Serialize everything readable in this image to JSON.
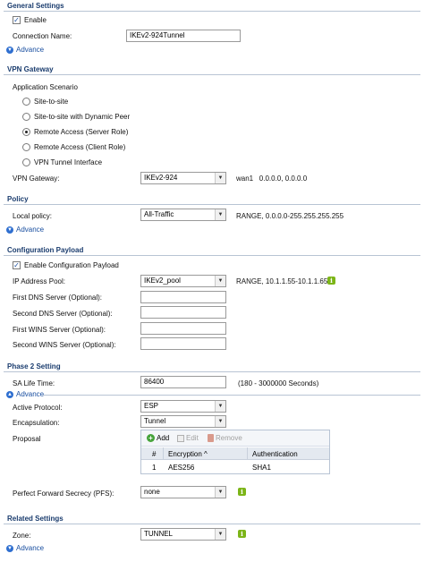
{
  "general": {
    "header": "General Settings",
    "enable_label": "Enable",
    "enable_checked": true,
    "connection_name_label": "Connection Name:",
    "connection_name_value": "IKEv2-924Tunnel",
    "advance_label": "Advance"
  },
  "vpn_gateway": {
    "header": "VPN Gateway",
    "scenario_label": "Application Scenario",
    "options": [
      {
        "label": "Site-to-site",
        "checked": false
      },
      {
        "label": "Site-to-site with Dynamic Peer",
        "checked": false
      },
      {
        "label": "Remote Access (Server Role)",
        "checked": true
      },
      {
        "label": "Remote Access (Client Role)",
        "checked": false
      },
      {
        "label": "VPN Tunnel Interface",
        "checked": false
      }
    ],
    "gateway_label": "VPN Gateway:",
    "gateway_value": "IKEv2-924",
    "gateway_info": "wan1   0.0.0.0, 0.0.0.0"
  },
  "policy": {
    "header": "Policy",
    "local_policy_label": "Local policy:",
    "local_policy_value": "All-Traffic",
    "local_policy_info": "RANGE, 0.0.0.0-255.255.255.255",
    "advance_label": "Advance"
  },
  "config_payload": {
    "header": "Configuration Payload",
    "enable_label": "Enable Configuration Payload",
    "enable_checked": true,
    "ip_pool_label": "IP Address Pool:",
    "ip_pool_value": "IKEv2_pool",
    "ip_pool_info": "RANGE, 10.1.1.55-10.1.1.65",
    "dns1_label": "First DNS Server (Optional):",
    "dns2_label": "Second DNS Server (Optional):",
    "wins1_label": "First WINS Server (Optional):",
    "wins2_label": "Second WINS Server (Optional):"
  },
  "phase2": {
    "header": "Phase 2 Setting",
    "sa_life_label": "SA Life Time:",
    "sa_life_value": "86400",
    "sa_life_info": "(180 - 3000000 Seconds)",
    "advance_label": "Advance",
    "protocol_label": "Active Protocol:",
    "protocol_value": "ESP",
    "encapsulation_label": "Encapsulation:",
    "encapsulation_value": "Tunnel",
    "proposal_label": "Proposal",
    "toolbar": {
      "add": "Add",
      "edit": "Edit",
      "remove": "Remove"
    },
    "table": {
      "headers": [
        "#",
        "Encryption ^",
        "Authentication"
      ],
      "rows": [
        [
          "1",
          "AES256",
          "SHA1"
        ]
      ]
    },
    "pfs_label": "Perfect Forward Secrecy (PFS):",
    "pfs_value": "none"
  },
  "related": {
    "header": "Related Settings",
    "zone_label": "Zone:",
    "zone_value": "TUNNEL",
    "advance_label": "Advance"
  },
  "icons": {
    "info": "i",
    "dropdown": "▼",
    "collapse": "▼",
    "expand": "▲",
    "add": "+",
    "check": "✓"
  },
  "colors": {
    "header_text": "#1a3c6e",
    "link": "#1a4fa0",
    "info_icon": "#7cb518"
  }
}
